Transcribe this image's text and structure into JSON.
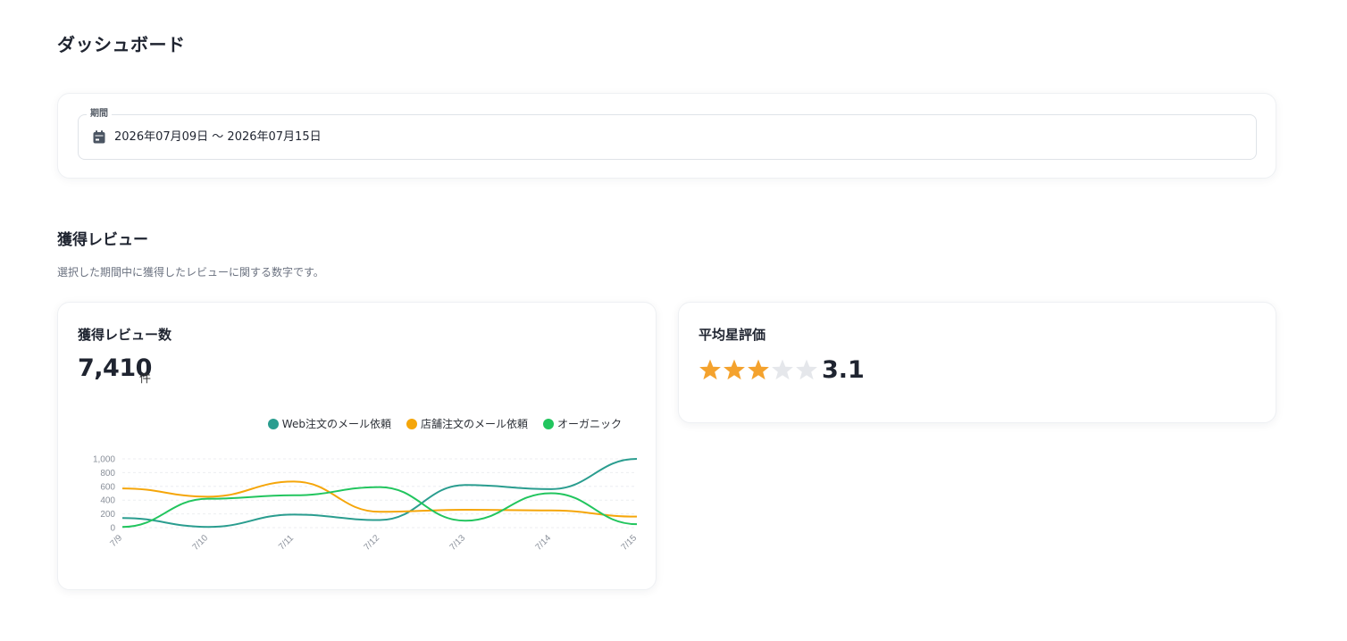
{
  "page": {
    "title": "ダッシュボード"
  },
  "period": {
    "label": "期間",
    "value": "2026年07月09日 〜 2026年07月15日",
    "icon": "calendar-icon"
  },
  "section": {
    "title": "獲得レビュー",
    "description": "選択した期間中に獲得したレビューに関する数字です。"
  },
  "reviews_card": {
    "title": "獲得レビュー数",
    "total": "7,410",
    "unit": "件"
  },
  "rating_card": {
    "title": "平均星評価",
    "value": "3.1",
    "stars_filled": 3,
    "stars_total": 5
  },
  "colors": {
    "web": "#2a9d8f",
    "store": "#f5a60a",
    "organic": "#22c55e",
    "star_on": "#f4a22d",
    "star_off": "#e5e7eb"
  },
  "chart_data": {
    "type": "line",
    "categories": [
      "7/9",
      "7/10",
      "7/11",
      "7/12",
      "7/13",
      "7/14",
      "7/15"
    ],
    "y_ticks": [
      "0",
      "200",
      "400",
      "600",
      "800",
      "1,000"
    ],
    "ylim": [
      0,
      1000
    ],
    "grid": true,
    "legend_position": "top-right",
    "series": [
      {
        "name": "Web注文のメール依頼",
        "color": "#2a9d8f",
        "values": [
          140,
          10,
          190,
          110,
          620,
          560,
          1000
        ]
      },
      {
        "name": "店舗注文のメール依頼",
        "color": "#f5a60a",
        "values": [
          570,
          450,
          670,
          230,
          260,
          250,
          160
        ]
      },
      {
        "name": "オーガニック",
        "color": "#22c55e",
        "values": [
          10,
          420,
          470,
          590,
          100,
          500,
          50
        ]
      }
    ]
  }
}
